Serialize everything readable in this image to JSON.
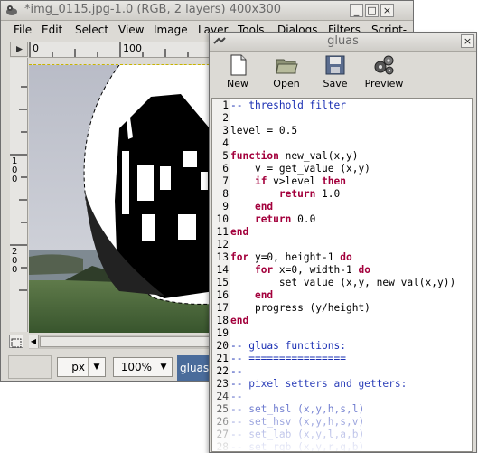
{
  "image_window": {
    "title": "*img_0115.jpg-1.0 (RGB, 2 layers) 400x300",
    "menu": [
      "File",
      "Edit",
      "Select",
      "View",
      "Image",
      "Layer",
      "Tools",
      "Dialogs",
      "Filters",
      "Script-"
    ],
    "ruler_top_ticks": [
      "0",
      "100"
    ],
    "ruler_left_ticks": [
      "1\n0\n0",
      "2\n0\n0"
    ],
    "unit_select": "px",
    "zoom_select": "100%",
    "status_task": "gluas"
  },
  "gluas_dialog": {
    "title": "gluas",
    "toolbar": [
      {
        "label": "New",
        "icon": "new-document-icon"
      },
      {
        "label": "Open",
        "icon": "open-folder-icon"
      },
      {
        "label": "Save",
        "icon": "save-floppy-icon"
      },
      {
        "label": "Preview",
        "icon": "preview-gears-icon"
      }
    ],
    "code_lines": [
      {
        "n": "1",
        "type": "comment",
        "text": "-- threshold filter"
      },
      {
        "n": "2",
        "type": "plain",
        "text": ""
      },
      {
        "n": "3",
        "type": "plain",
        "text": "level = 0.5"
      },
      {
        "n": "4",
        "type": "plain",
        "text": ""
      },
      {
        "n": "5",
        "type": "kwline",
        "kw": "function",
        "text": " new_val(x,y)"
      },
      {
        "n": "6",
        "type": "plain",
        "text": "    v = get_value (x,y)"
      },
      {
        "n": "7",
        "type": "if",
        "text": "    if v>level then"
      },
      {
        "n": "8",
        "type": "kwline",
        "pre": "        ",
        "kw": "return",
        "text": " 1.0"
      },
      {
        "n": "9",
        "type": "kwonly",
        "pre": "    ",
        "kw": "end",
        "text": ""
      },
      {
        "n": "10",
        "type": "kwline",
        "pre": "    ",
        "kw": "return",
        "text": " 0.0"
      },
      {
        "n": "11",
        "type": "kwonly",
        "pre": "",
        "kw": "end",
        "text": ""
      },
      {
        "n": "12",
        "type": "plain",
        "text": ""
      },
      {
        "n": "13",
        "type": "kwline2",
        "pre": "",
        "kw": "for",
        "text": " y=0, height-1 ",
        "kw2": "do"
      },
      {
        "n": "14",
        "type": "kwline2",
        "pre": "    ",
        "kw": "for",
        "text": " x=0, width-1 ",
        "kw2": "do"
      },
      {
        "n": "15",
        "type": "plain",
        "text": "        set_value (x,y, new_val(x,y))"
      },
      {
        "n": "16",
        "type": "kwonly",
        "pre": "    ",
        "kw": "end",
        "text": ""
      },
      {
        "n": "17",
        "type": "plain",
        "text": "    progress (y/height)"
      },
      {
        "n": "18",
        "type": "kwonly",
        "pre": "",
        "kw": "end",
        "text": ""
      },
      {
        "n": "19",
        "type": "plain",
        "text": ""
      },
      {
        "n": "20",
        "type": "comment",
        "text": "-- gluas functions:"
      },
      {
        "n": "21",
        "type": "comment",
        "text": "-- ================"
      },
      {
        "n": "22",
        "type": "comment",
        "text": "--"
      },
      {
        "n": "23",
        "type": "comment",
        "text": "-- pixel setters and getters:"
      },
      {
        "n": "24",
        "type": "comment",
        "text": "--"
      },
      {
        "n": "25",
        "type": "comment",
        "text": "-- set_hsl (x,y,h,s,l)"
      },
      {
        "n": "26",
        "type": "comment",
        "text": "-- set_hsv (x,y,h,s,v)"
      },
      {
        "n": "27",
        "type": "comment",
        "text": "-- set_lab (x,y,l,a,b)"
      },
      {
        "n": "28",
        "type": "comment",
        "text": "-- set_rgb (x,y,r,g,b)"
      }
    ]
  },
  "colors": {
    "keyword": "#a3003c",
    "comment": "#1a2fb3",
    "task_button": "#4a6c9b"
  }
}
